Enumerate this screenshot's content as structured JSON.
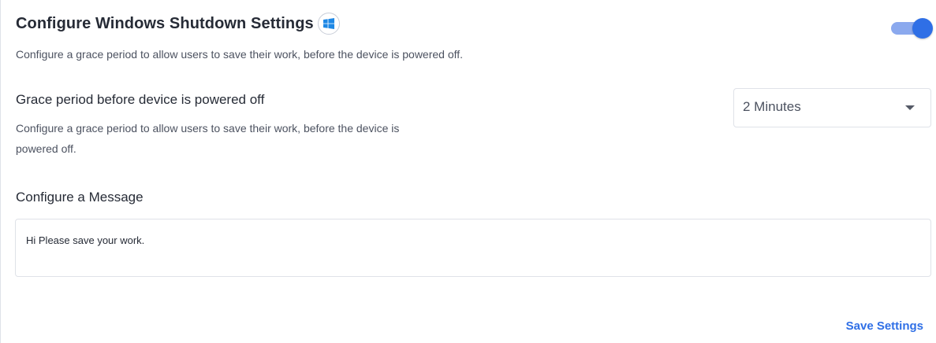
{
  "section": {
    "title": "Configure Windows Shutdown Settings",
    "os_icon": "windows-logo-icon",
    "description": "Configure a grace period to allow users to save their work, before the device is powered off.",
    "enabled": true
  },
  "grace_period": {
    "title": "Grace period before device is powered off",
    "description": "Configure a grace period to allow users to save their work, before the device is powered off.",
    "selected": "2 Minutes"
  },
  "message": {
    "title": "Configure a Message",
    "value": "Hi Please save your work."
  },
  "actions": {
    "save_label": "Save Settings"
  },
  "colors": {
    "accent": "#2f6fe6",
    "toggle_track": "#8ba9ee",
    "windows_logo": "#1e88e5"
  }
}
